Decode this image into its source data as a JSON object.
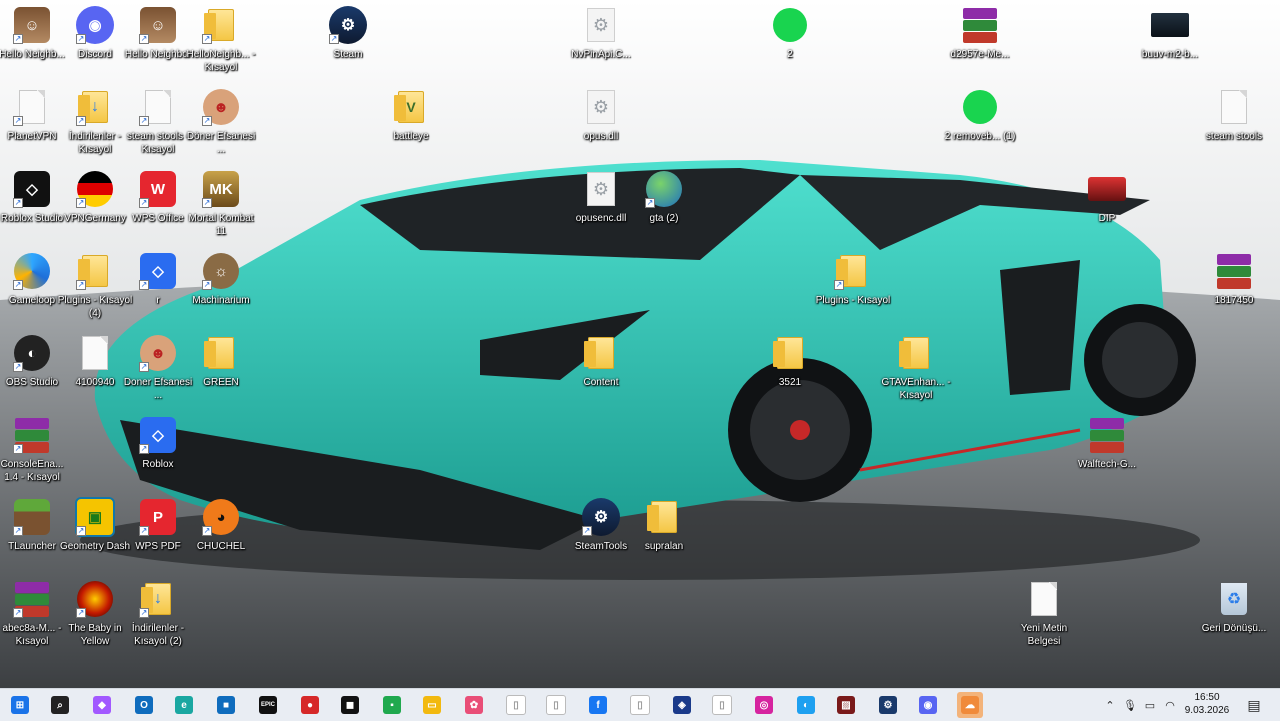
{
  "desktop": {
    "icons": [
      {
        "label": "Hello Neighb...",
        "kind": "game-hello-neighbor-icon"
      },
      {
        "label": "Discord",
        "kind": "discord-icon"
      },
      {
        "label": "Hello Neighbor",
        "kind": "game-hello-neighbor-icon"
      },
      {
        "label": "HelloNeighb... - Kısayol",
        "kind": "folder-icon"
      },
      {
        "label": "Steam",
        "kind": "steam-icon"
      },
      {
        "label": "NvPinApi.C...",
        "kind": "settings-file-icon"
      },
      {
        "label": "2",
        "kind": "green-circle-icon"
      },
      {
        "label": "d2957e-Me...",
        "kind": "winrar-icon"
      },
      {
        "label": "buuv-m2-b...",
        "kind": "image-thumbnail-icon"
      },
      {
        "label": "PlanetVPN",
        "kind": "file-icon"
      },
      {
        "label": "İndirilenler - Kısayol",
        "kind": "downloads-folder-icon"
      },
      {
        "label": "steam stools - Kısayol",
        "kind": "file-icon"
      },
      {
        "label": "Döner Efsanesi ...",
        "kind": "doner-game-icon"
      },
      {
        "label": "battleye",
        "kind": "battleye-folder-icon"
      },
      {
        "label": "opus.dll",
        "kind": "settings-file-icon"
      },
      {
        "label": "2 removeb... (1)",
        "kind": "green-circle-icon"
      },
      {
        "label": "steam stools",
        "kind": "file-icon"
      },
      {
        "label": "Roblox Studio",
        "kind": "roblox-studio-icon"
      },
      {
        "label": "VPNGermany",
        "kind": "vpn-germany-icon"
      },
      {
        "label": "WPS Office",
        "kind": "wps-office-icon"
      },
      {
        "label": "Mortal Kombat 11",
        "kind": "mortal-kombat-icon"
      },
      {
        "label": "opusenc.dll",
        "kind": "settings-file-icon"
      },
      {
        "label": "gta (2)",
        "kind": "globe-icon"
      },
      {
        "label": "DIP",
        "kind": "car-thumbnail-icon"
      },
      {
        "label": "Gameloop",
        "kind": "gameloop-icon"
      },
      {
        "label": "Plugins - Kısayol (4)",
        "kind": "folder-icon"
      },
      {
        "label": "r",
        "kind": "roblox-icon"
      },
      {
        "label": "Machinarium",
        "kind": "machinarium-icon"
      },
      {
        "label": "Plugins - Kısayol",
        "kind": "folder-icon"
      },
      {
        "label": "1817450",
        "kind": "winrar-icon"
      },
      {
        "label": "OBS Studio",
        "kind": "obs-icon"
      },
      {
        "label": "4100940",
        "kind": "file-icon"
      },
      {
        "label": "Doner Efsanesi ...",
        "kind": "doner-game-icon"
      },
      {
        "label": "GREEN",
        "kind": "folder-icon"
      },
      {
        "label": "Content",
        "kind": "folder-icon"
      },
      {
        "label": "3521",
        "kind": "folder-icon"
      },
      {
        "label": "GTAVEnhan... - Kısayol",
        "kind": "folder-icon"
      },
      {
        "label": "ConsoleEna... 1.4 - Kısayol",
        "kind": "winrar-icon"
      },
      {
        "label": "Roblox",
        "kind": "roblox-icon"
      },
      {
        "label": "Walftech-G...",
        "kind": "winrar-icon"
      },
      {
        "label": "TLauncher",
        "kind": "minecraft-icon"
      },
      {
        "label": "Geometry Dash",
        "kind": "geometry-dash-icon"
      },
      {
        "label": "WPS PDF",
        "kind": "wps-pdf-icon"
      },
      {
        "label": "CHUCHEL",
        "kind": "chuchel-icon"
      },
      {
        "label": "SteamTools",
        "kind": "steam-icon"
      },
      {
        "label": "supralan",
        "kind": "folder-icon"
      },
      {
        "label": "abec8a-M... - Kısayol",
        "kind": "winrar-icon"
      },
      {
        "label": "The Baby in Yellow",
        "kind": "baby-in-yellow-icon"
      },
      {
        "label": "İndirilenler - Kısayol (2)",
        "kind": "downloads-folder-icon"
      },
      {
        "label": "Yeni Metin Belgesi",
        "kind": "file-icon"
      },
      {
        "label": "Geri Dönüşü...",
        "kind": "recycle-bin-icon"
      }
    ]
  },
  "taskbar": {
    "apps": [
      {
        "name": "start-button",
        "glyph": "⊞"
      },
      {
        "name": "search-button",
        "glyph": "⌕"
      },
      {
        "name": "copilot-app",
        "glyph": "◆"
      },
      {
        "name": "outlook-app",
        "glyph": "O"
      },
      {
        "name": "edge-app",
        "glyph": "e"
      },
      {
        "name": "store-app",
        "glyph": "■"
      },
      {
        "name": "epic-games-app",
        "glyph": "EPIC"
      },
      {
        "name": "chrome-like-app",
        "glyph": "●"
      },
      {
        "name": "roblox-app",
        "glyph": "◼"
      },
      {
        "name": "nvidia-app",
        "glyph": "▪"
      },
      {
        "name": "file-explorer-app",
        "glyph": "▭"
      },
      {
        "name": "photos-app",
        "glyph": "✿"
      },
      {
        "name": "file-app",
        "glyph": "▯"
      },
      {
        "name": "file-app-2",
        "glyph": "▯"
      },
      {
        "name": "facebook-app",
        "glyph": "f"
      },
      {
        "name": "file-app-3",
        "glyph": "▯"
      },
      {
        "name": "game-app",
        "glyph": "◈"
      },
      {
        "name": "file-app-4",
        "glyph": "▯"
      },
      {
        "name": "instagram-app",
        "glyph": "◎"
      },
      {
        "name": "gameloop-app",
        "glyph": "◐"
      },
      {
        "name": "game-thumbnail-app",
        "glyph": "▨"
      },
      {
        "name": "steam-app",
        "glyph": "⚙"
      },
      {
        "name": "discord-app",
        "glyph": "◉"
      },
      {
        "name": "active-app",
        "glyph": "☁"
      }
    ],
    "clock": {
      "time": "16:50",
      "date": "9.03.2026"
    }
  },
  "colors": {
    "taskbar_bg": "#e9edf3",
    "car": "#2fc7b8",
    "accent": "#f3b37a"
  }
}
